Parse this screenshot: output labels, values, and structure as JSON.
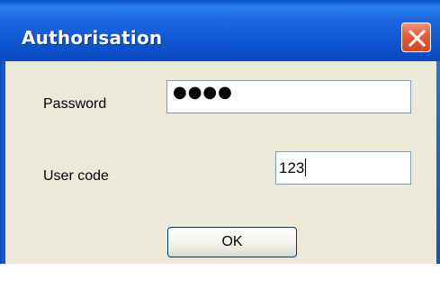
{
  "window": {
    "title": "Authorisation"
  },
  "form": {
    "password_label": "Password",
    "password_mask": "●●●●",
    "usercode_label": "User code",
    "usercode_value": "123"
  },
  "buttons": {
    "ok_label": "OK"
  },
  "icons": {
    "close": "close-icon"
  },
  "colors": {
    "titlebar": "#1d66e0",
    "client_bg": "#ece9d8",
    "close_button": "#e6603c",
    "field_border": "#7f9db9"
  }
}
